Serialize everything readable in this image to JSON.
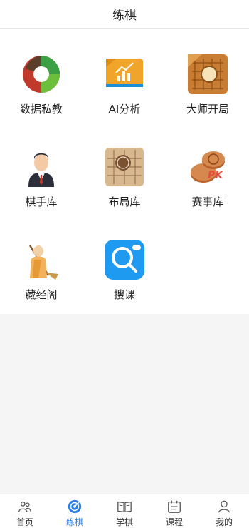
{
  "header": {
    "title": "练棋"
  },
  "grid": {
    "items": [
      {
        "label": "数据私教",
        "icon": "data-coach-icon"
      },
      {
        "label": "AI分析",
        "icon": "ai-analysis-icon"
      },
      {
        "label": "大师开局",
        "icon": "master-opening-icon"
      },
      {
        "label": "棋手库",
        "icon": "player-database-icon"
      },
      {
        "label": "布局库",
        "icon": "opening-database-icon"
      },
      {
        "label": "赛事库",
        "icon": "tournament-database-icon"
      },
      {
        "label": "藏经阁",
        "icon": "library-monk-icon"
      },
      {
        "label": "搜课",
        "icon": "search-course-icon"
      }
    ]
  },
  "tabbar": {
    "active": 1,
    "tabs": [
      {
        "label": "首页",
        "icon": "home-icon"
      },
      {
        "label": "练棋",
        "icon": "practice-target-icon"
      },
      {
        "label": "学棋",
        "icon": "book-icon"
      },
      {
        "label": "课程",
        "icon": "course-icon"
      },
      {
        "label": "我的",
        "icon": "profile-icon"
      }
    ]
  },
  "colors": {
    "accent": "#2a7ee6",
    "background": "#f5f5f5"
  }
}
